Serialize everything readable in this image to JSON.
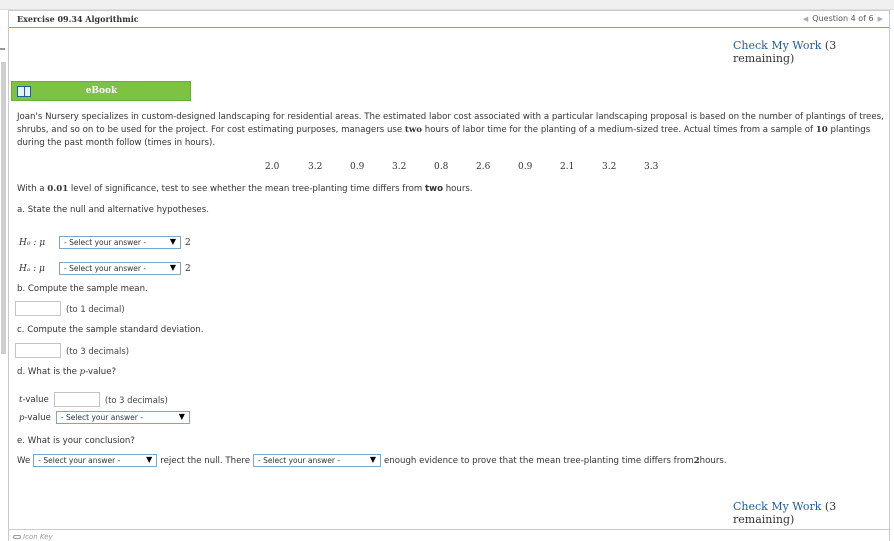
{
  "header": {
    "exercise_title": "Exercise 09.34 Algorithmic",
    "question_nav": "Question 4 of 6"
  },
  "check_work": {
    "label": "Check My Work",
    "remaining": "(3 remaining)"
  },
  "ebook": {
    "label": "eBook",
    "icon": "book-icon"
  },
  "prompt": {
    "text_before_two": "Joan's Nursery specializes in custom-designed landscaping for residential areas. The estimated labor cost associated with a particular landscaping proposal is based on the number of plantings of trees, shrubs, and so on to be used for the project. For cost estimating purposes, managers use ",
    "two": "two",
    "text_between": " hours of labor time for the planting of a medium-sized tree. Actual times from a sample of ",
    "ten": "10",
    "text_after": " plantings during the past month follow (times in hours)."
  },
  "data_values": [
    "2.0",
    "3.2",
    "0.9",
    "3.2",
    "0.8",
    "2.6",
    "0.9",
    "2.1",
    "3.2",
    "3.3"
  ],
  "significance": {
    "pre": "With a ",
    "alpha": "0.01",
    "mid": " level of significance, test to see whether the mean tree-planting time differs from ",
    "two": "two",
    "post": " hours."
  },
  "part_a": {
    "label": "a. State the null and alternative hypotheses.",
    "h0_symbol": "H₀ : μ",
    "ha_symbol": "Hₐ : μ",
    "h0_select": "- Select your answer -",
    "ha_select": "- Select your answer -",
    "value": "2"
  },
  "part_b": {
    "label": "b. Compute the sample mean.",
    "hint": "(to 1 decimal)"
  },
  "part_c": {
    "label": "c. Compute the sample standard deviation.",
    "hint": "(to 3 decimals)"
  },
  "part_d": {
    "label_pre": "d. What is the ",
    "label_var": "p",
    "label_post": "-value?",
    "t_var": "t",
    "t_label": "-value",
    "t_hint": "(to 3 decimals)",
    "p_var": "p",
    "p_label": "-value",
    "p_select": "- Select your answer -"
  },
  "part_e": {
    "label": "e. What is your conclusion?",
    "we": "We",
    "select1": "- Select your answer -",
    "mid": "reject the null. There",
    "select2": "- Select your answer -",
    "post_pre": "enough evidence to prove that the mean tree-planting time differs from ",
    "post_num": "2",
    "post_end": " hours."
  },
  "footer": {
    "icon_key": "Icon Key"
  }
}
